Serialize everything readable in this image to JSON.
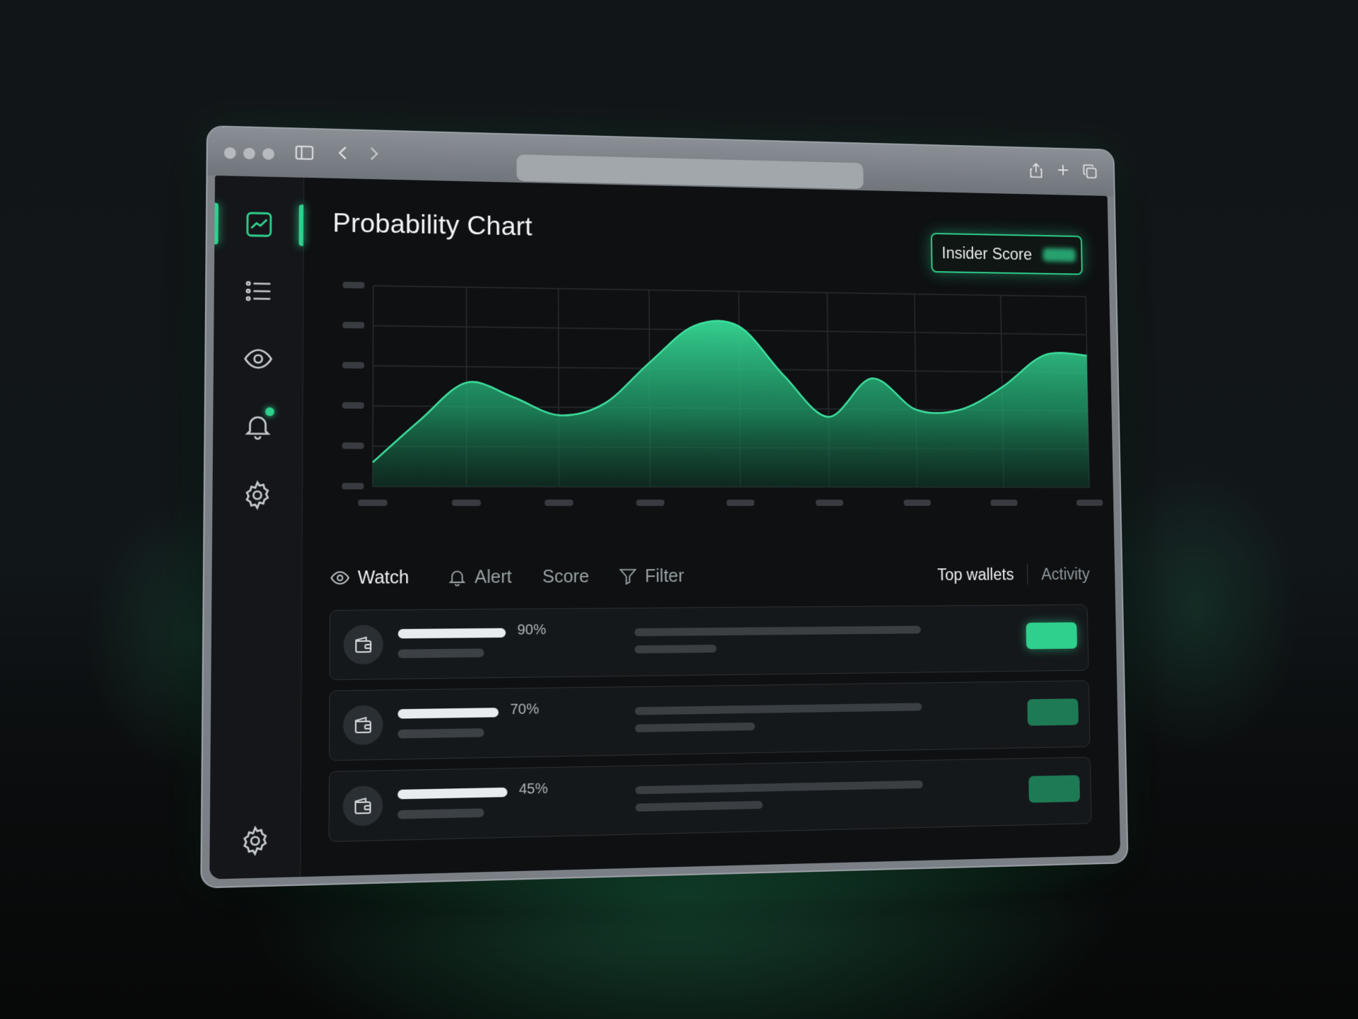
{
  "page": {
    "title": "Probability Chart"
  },
  "insider_score": {
    "label": "Insider Score",
    "value": ""
  },
  "sidebar": {
    "items": [
      {
        "name": "chart",
        "active": true,
        "icon": "line-chart-icon"
      },
      {
        "name": "list",
        "active": false,
        "icon": "list-icon"
      },
      {
        "name": "watch",
        "active": false,
        "icon": "eye-icon"
      },
      {
        "name": "alerts",
        "active": false,
        "icon": "bell-icon",
        "badge": true
      },
      {
        "name": "settings",
        "active": false,
        "icon": "gear-icon"
      },
      {
        "name": "settings-bottom",
        "active": false,
        "icon": "gear-icon"
      }
    ]
  },
  "toolbar": {
    "watch": "Watch",
    "alert": "Alert",
    "score": "Score",
    "filter": "Filter"
  },
  "tabs": {
    "top_wallets": "Top wallets",
    "activity": "Activity",
    "active": "Top wallets"
  },
  "wallets": [
    {
      "percent": "90%",
      "progress": 0.9,
      "amount": "",
      "highlight": true
    },
    {
      "percent": "70%",
      "progress": 0.7,
      "amount": "",
      "highlight": false
    },
    {
      "percent": "45%",
      "progress": 0.45,
      "amount": "",
      "highlight": false
    }
  ],
  "colors": {
    "accent": "#2fd08e",
    "background": "#0e1012",
    "panel": "#15181b"
  },
  "chart_data": {
    "type": "area",
    "title": "Probability Chart",
    "x": [
      0,
      0.5,
      1,
      1.5,
      2,
      2.5,
      3,
      3.5,
      4,
      4.5,
      5,
      5.5,
      6,
      6.5,
      7,
      7.5,
      8
    ],
    "values": [
      12,
      33,
      52,
      45,
      36,
      42,
      63,
      82,
      82,
      57,
      36,
      56,
      40,
      40,
      52,
      69,
      69
    ],
    "ylim": [
      0,
      100
    ],
    "yticks_count": 6,
    "grid": true
  }
}
